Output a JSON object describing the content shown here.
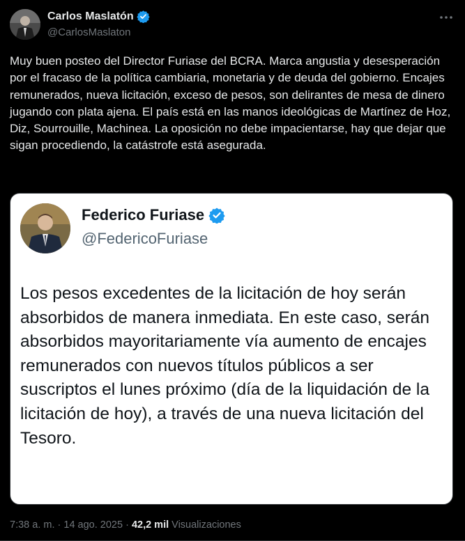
{
  "author": {
    "name": "Carlos Maslatón",
    "handle": "@CarlosMaslaton"
  },
  "tweet_text": "Muy buen posteo del Director Furiase del BCRA. Marca angustia y desesperación por el fracaso de la política cambiaria, monetaria y de deuda del gobierno. Encajes remunerados, nueva licitación, exceso de pesos, son delirantes de mesa de dinero jugando con plata ajena. El país está en las manos ideológicas de Martínez de Hoz, Diz, Sourrouille, Machinea. La oposición no debe impacientarse, hay que dejar que sigan procediendo, la catástrofe está asegurada.",
  "quoted": {
    "name": "Federico Furiase",
    "handle": "@FedericoFuriase",
    "text": "Los pesos excedentes de la licitación de hoy serán absorbidos de manera inmediata. En este caso, serán absorbidos mayoritariamente vía aumento de encajes remunerados con nuevos títulos públicos a ser suscriptos el lunes próximo (día de la liquidación de la licitación de hoy), a través de una nueva licitación del Tesoro."
  },
  "meta": {
    "time": "7:38 a. m.",
    "separator": " · ",
    "date": "14 ago. 2025",
    "views_count": "42,2 mil",
    "views_label": "Visualizaciones"
  },
  "icons": {
    "verified": "verified-badge-icon",
    "more": "more-options-icon"
  },
  "colors": {
    "background": "#000000",
    "text": "#e7e9ea",
    "muted": "#71767b",
    "verified": "#1d9bf0"
  }
}
